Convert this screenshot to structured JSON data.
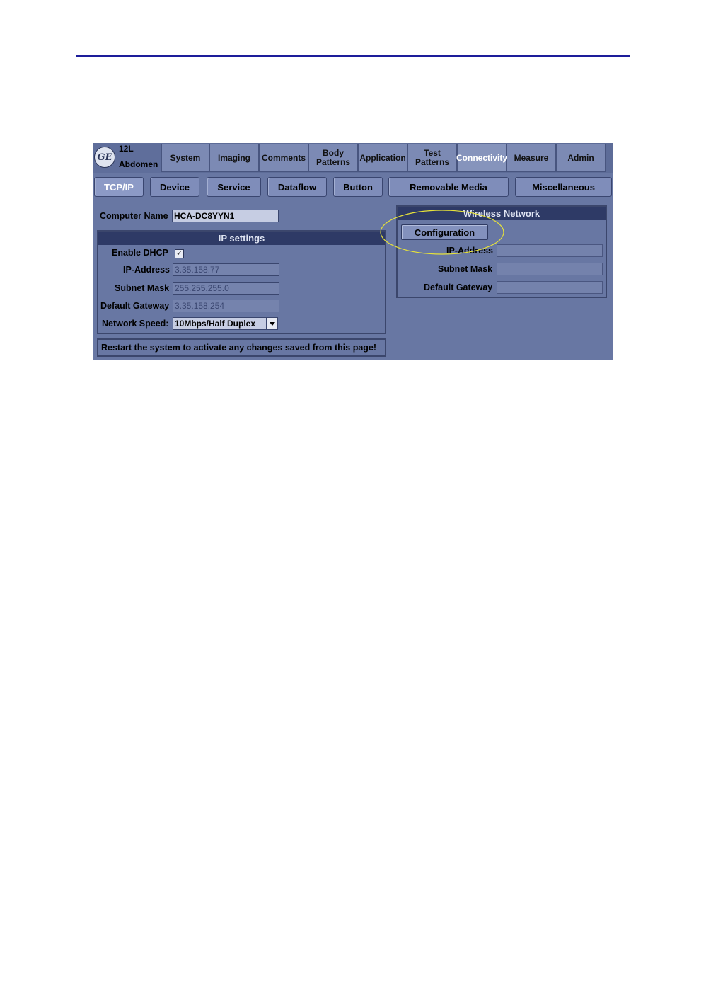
{
  "app": {
    "probe": "12L",
    "preset": "Abdomen",
    "logo_text": "GE"
  },
  "top_tabs": [
    {
      "label": "System",
      "active": false
    },
    {
      "label": "Imaging",
      "active": false
    },
    {
      "label": "Comments",
      "active": false
    },
    {
      "label": "Body\nPatterns",
      "active": false
    },
    {
      "label": "Application",
      "active": false
    },
    {
      "label": "Test\nPatterns",
      "active": false
    },
    {
      "label": "Connectivity",
      "active": true
    },
    {
      "label": "Measure",
      "active": false
    },
    {
      "label": "Admin",
      "active": false
    }
  ],
  "sub_tabs": [
    {
      "label": "TCP/IP",
      "active": true
    },
    {
      "label": "Device",
      "active": false
    },
    {
      "label": "Service",
      "active": false
    },
    {
      "label": "Dataflow",
      "active": false
    },
    {
      "label": "Button",
      "active": false
    },
    {
      "label": "Removable Media",
      "active": false
    },
    {
      "label": "Miscellaneous",
      "active": false
    }
  ],
  "computer_name": {
    "label": "Computer Name",
    "value": "HCA-DC8YYN1"
  },
  "ip_settings": {
    "header": "IP settings",
    "enable_dhcp_label": "Enable DHCP",
    "enable_dhcp_checked": true,
    "check_glyph": "✓",
    "ip_address_label": "IP-Address",
    "ip_address_value": "3.35.158.77",
    "subnet_mask_label": "Subnet Mask",
    "subnet_mask_value": "255.255.255.0",
    "default_gateway_label": "Default Gateway",
    "default_gateway_value": "3.35.158.254",
    "network_speed_label": "Network Speed:",
    "network_speed_value": "10Mbps/Half Duplex"
  },
  "wireless": {
    "header": "Wireless Network",
    "configuration_button": "Configuration",
    "ip_address_label": "IP-Address",
    "ip_address_value": "",
    "subnet_mask_label": "Subnet Mask",
    "subnet_mask_value": "",
    "default_gateway_label": "Default Gateway",
    "default_gateway_value": "",
    "highlight_color": "#e6e23a"
  },
  "restart_message": "Restart the system to activate any changes saved from this page!",
  "colors": {
    "panel": "#6877a3",
    "header_bar": "#2e3a66",
    "rule": "#1d1d9a"
  }
}
